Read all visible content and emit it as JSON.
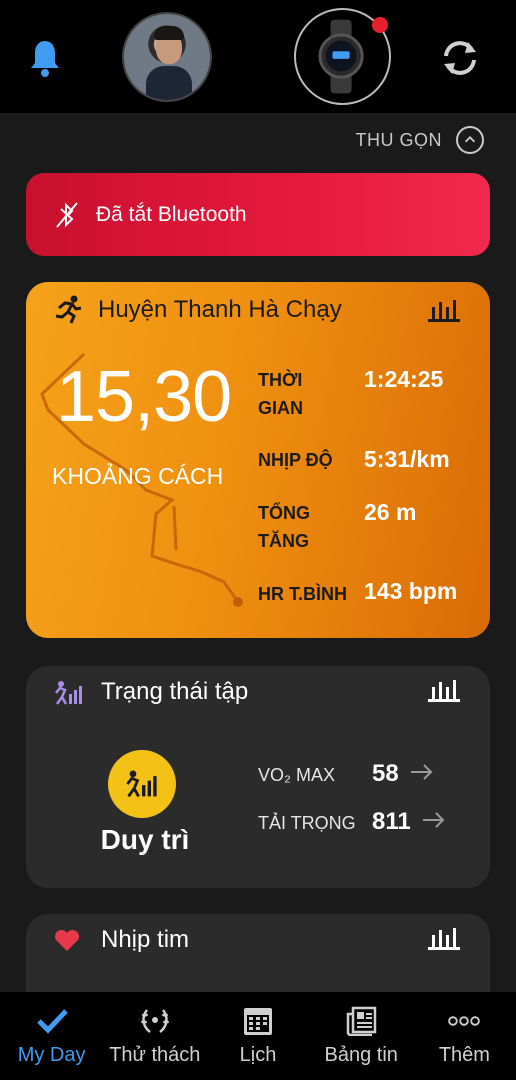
{
  "header": {
    "bell_icon": "bell-icon",
    "avatar_icon": "avatar",
    "device_icon": "watch-icon",
    "sync_icon": "sync-icon",
    "accent": "#3f9cf0",
    "notification_dot_color": "#e8202e"
  },
  "collapse": {
    "label": "THU GỌN",
    "icon": "chevron-up-icon"
  },
  "bluetooth": {
    "label": "Đã tắt Bluetooth",
    "icon": "bluetooth-off-icon",
    "color": "#e8193f"
  },
  "activity": {
    "title": "Huyện Thanh Hà Chạy",
    "distance_value": "15,30",
    "distance_label": "KHOẢNG CÁCH",
    "stats": [
      {
        "label_line1": "THỜI",
        "label_line2": "GIAN",
        "value": "1:24:25"
      },
      {
        "label_line1": "NHỊP ĐỘ",
        "label_line2": "",
        "value": "5:31/km"
      },
      {
        "label_line1": "TỔNG",
        "label_line2": "TĂNG",
        "value": "26 m"
      },
      {
        "label_line1": "HR T.BÌNH",
        "label_line2": "",
        "value": "143 bpm"
      }
    ],
    "color": "#ef8f10"
  },
  "training_status": {
    "title": "Trạng thái tập",
    "status": "Duy trì",
    "status_color": "#f4c116",
    "metrics": [
      {
        "label": "VO₂ MAX",
        "value": "58"
      },
      {
        "label": "TẢI TRỌNG",
        "value": "811"
      }
    ]
  },
  "heart_rate": {
    "title": "Nhịp tim",
    "icon": "heart-icon",
    "color": "#e8394a"
  },
  "nav": {
    "items": [
      {
        "label": "My Day",
        "icon": "checkmark-icon",
        "active": true
      },
      {
        "label": "Thử thách",
        "icon": "laurel-icon",
        "active": false
      },
      {
        "label": "Lịch",
        "icon": "calendar-icon",
        "active": false
      },
      {
        "label": "Bảng tin",
        "icon": "newsfeed-icon",
        "active": false
      },
      {
        "label": "Thêm",
        "icon": "more-icon",
        "active": false
      }
    ]
  }
}
